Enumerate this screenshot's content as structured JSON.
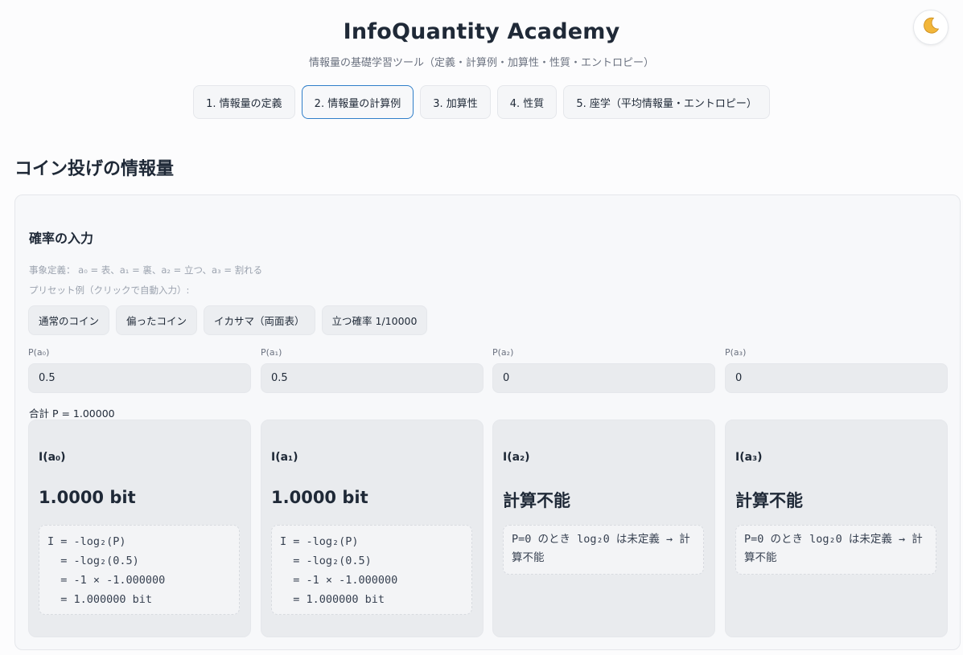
{
  "header": {
    "title": "InfoQuantity Academy",
    "subtitle": "情報量の基礎学習ツール（定義・計算例・加算性・性質・エントロピー）",
    "theme_icon": "moon-icon"
  },
  "tabs": [
    {
      "label": "1. 情報量の定義",
      "active": false
    },
    {
      "label": "2. 情報量の計算例",
      "active": true
    },
    {
      "label": "3. 加算性",
      "active": false
    },
    {
      "label": "4. 性質",
      "active": false
    },
    {
      "label": "5. 座学（平均情報量・エントロピー）",
      "active": false
    }
  ],
  "section": {
    "title": "コイン投げの情報量"
  },
  "panel": {
    "title": "確率の入力",
    "event_definition": "事象定義： a₀ = 表、a₁ = 裏、a₂ = 立つ、a₃ = 割れる",
    "preset_label": "プリセット例（クリックで自動入力）:",
    "presets": [
      "通常のコイン",
      "偏ったコイン",
      "イカサマ（両面表）",
      "立つ確率 1/10000"
    ],
    "probabilities": [
      {
        "label": "P(a₀)",
        "value": "0.5"
      },
      {
        "label": "P(a₁)",
        "value": "0.5"
      },
      {
        "label": "P(a₂)",
        "value": "0"
      },
      {
        "label": "P(a₃)",
        "value": "0"
      }
    ],
    "sum": "合計 P = 1.00000",
    "results": [
      {
        "label": "I(a₀)",
        "value": "1.0000 bit",
        "lines": [
          "I = -log₂(P)",
          "  = -log₂(0.5)",
          "  = -1 × -1.000000",
          "  = 1.000000 bit"
        ]
      },
      {
        "label": "I(a₁)",
        "value": "1.0000 bit",
        "lines": [
          "I = -log₂(P)",
          "  = -log₂(0.5)",
          "  = -1 × -1.000000",
          "  = 1.000000 bit"
        ]
      },
      {
        "label": "I(a₂)",
        "value": "計算不能",
        "note": "P=0 のとき log₂0 は未定義 → 計算不能"
      },
      {
        "label": "I(a₃)",
        "value": "計算不能",
        "note": "P=0 のとき log₂0 は未定義 → 計算不能"
      }
    ]
  }
}
